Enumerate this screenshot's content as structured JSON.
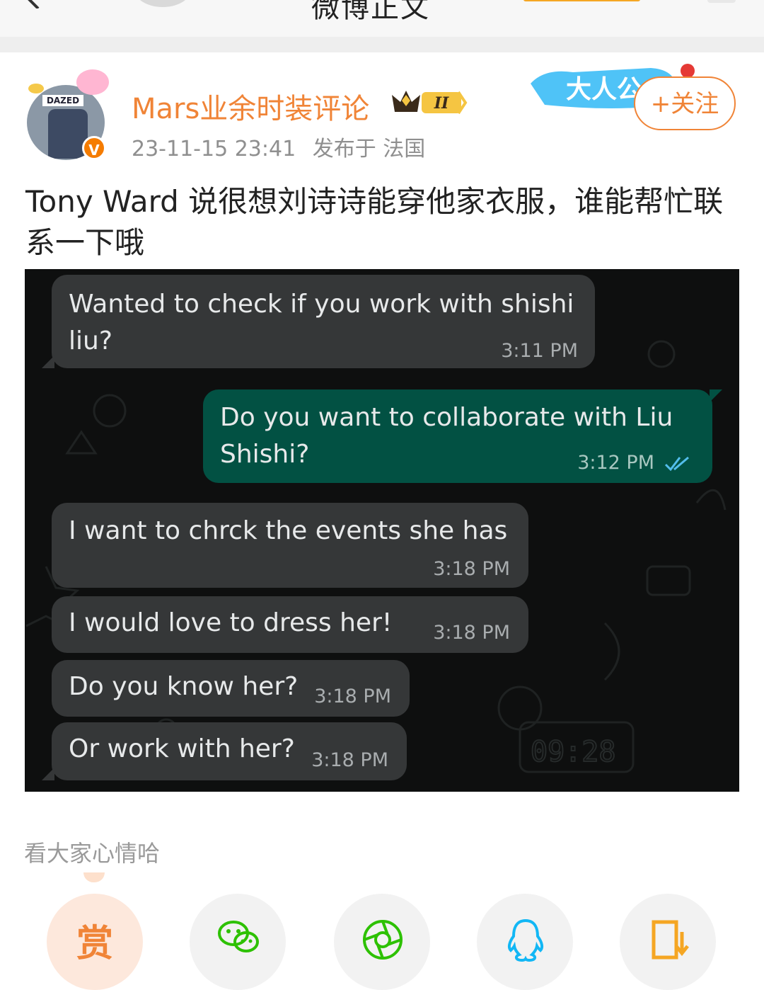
{
  "header": {
    "title": "微博正文"
  },
  "post": {
    "author": "Mars业余时装评论",
    "vip_level": "II",
    "timestamp": "23-11-15 23:41",
    "location": "发布于 法国",
    "follow_label": "+关注",
    "banner_text": "大人公",
    "avatar_text": "DAZED",
    "text": "Tony Ward 说很想刘诗诗能穿他家衣服，谁能帮忙联系一下哦"
  },
  "chat": {
    "messages": [
      {
        "direction": "in",
        "text": "Wanted to check if you work with shishi\nliu?",
        "time": "3:11 PM"
      },
      {
        "direction": "out",
        "text": "Do you want to collaborate with Liu\nShishi?",
        "time": "3:12 PM",
        "status": "read"
      },
      {
        "direction": "in",
        "text": "I want to chrck the events she has",
        "time": "3:18 PM"
      },
      {
        "direction": "in",
        "text": "I would love to dress her!",
        "time": "3:18 PM"
      },
      {
        "direction": "in",
        "text": "Do you know her?",
        "time": "3:18 PM"
      },
      {
        "direction": "in",
        "text": "Or work with her?",
        "time": "3:18 PM"
      }
    ],
    "wallpaper_clock": "09:28"
  },
  "mood_label": "看大家心情哈",
  "share": {
    "reward_label": "赏",
    "icons": [
      "reward-icon",
      "wechat-icon",
      "moments-icon",
      "qq-icon",
      "save-icon"
    ]
  },
  "colors": {
    "accent": "#f08437",
    "chat_incoming": "#353738",
    "chat_outgoing": "#025143",
    "chat_background": "#0e0f0f"
  }
}
